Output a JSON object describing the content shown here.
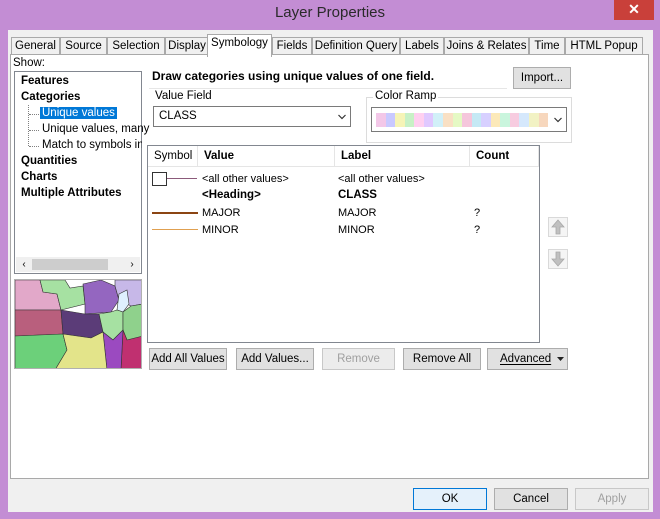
{
  "window": {
    "title": "Layer Properties",
    "close_glyph": "✕"
  },
  "tabs": [
    "General",
    "Source",
    "Selection",
    "Display",
    "Symbology",
    "Fields",
    "Definition Query",
    "Labels",
    "Joins & Relates",
    "Time",
    "HTML Popup"
  ],
  "show": {
    "label": "Show:",
    "items": [
      "Features",
      "Categories",
      "Unique values",
      "Unique values, many",
      "Match to symbols in a",
      "Quantities",
      "Charts",
      "Multiple Attributes"
    ]
  },
  "header": {
    "description": "Draw categories using unique values of one field.",
    "import_label": "Import..."
  },
  "value_field": {
    "label": "Value Field",
    "value": "CLASS"
  },
  "color_ramp": {
    "label": "Color Ramp",
    "colors": [
      "#f3c7e8",
      "#c9c9ff",
      "#f6f4b7",
      "#c8f1c6",
      "#ffd0f0",
      "#e0c9ff",
      "#d1f0f8",
      "#f9e0c4",
      "#e5f9c4",
      "#f5c6dc",
      "#c5e9f5",
      "#d7d0ff",
      "#fce9b9",
      "#c9f5dd",
      "#f7cce0",
      "#d5e8fc",
      "#f2f2c4",
      "#f7d7bd"
    ]
  },
  "table": {
    "headers": {
      "symbol": "Symbol",
      "value": "Value",
      "label": "Label",
      "count": "Count"
    },
    "rows": [
      {
        "value": "<all other values>",
        "label": "<all other values>",
        "count": "",
        "symbol": "box-line",
        "color": "#8b5a7a",
        "bold": false
      },
      {
        "value": "<Heading>",
        "label": "CLASS",
        "count": "",
        "symbol": "none",
        "bold": true
      },
      {
        "value": "MAJOR",
        "label": "MAJOR",
        "count": "?",
        "symbol": "line",
        "color": "#8b4513",
        "bold": false
      },
      {
        "value": "MINOR",
        "label": "MINOR",
        "count": "?",
        "symbol": "line",
        "color": "#e0a050",
        "bold": false
      }
    ]
  },
  "buttons": {
    "add_all": "Add All Values",
    "add": "Add Values...",
    "remove": "Remove",
    "remove_all": "Remove All",
    "advanced": "Advanced"
  },
  "footer": {
    "ok": "OK",
    "cancel": "Cancel",
    "apply": "Apply"
  }
}
